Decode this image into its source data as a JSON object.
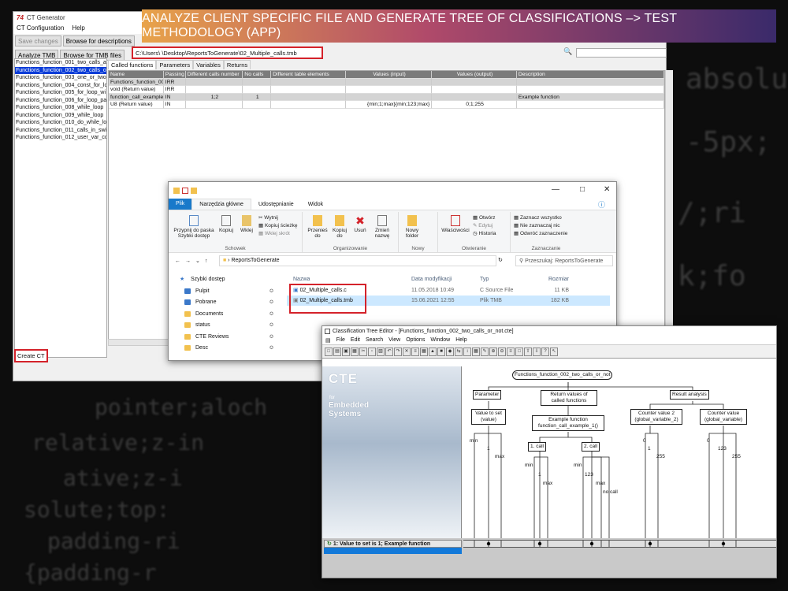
{
  "banner": "ANALYZE CLIENT SPECIFIC FILE AND GENERATE TREE OF CLASSIFICATIONS –> TEST METHODOLOGY (APP)",
  "bg_code": [
    "absolu",
    "-5px;",
    "/;ri",
    "k;fo",
    "pointer;aloch",
    "relative;z-in",
    "ative;z-i",
    "solute;top:",
    "padding-ri",
    "{padding-r"
  ],
  "ctgen": {
    "title": "CT Generator",
    "menu": [
      "CT Configuration",
      "Help"
    ],
    "toolbar1": [
      "Save changes",
      "Browse for descriptions"
    ],
    "toolbar2": [
      "Analyze TMB",
      "Browse for TMB files"
    ],
    "path": "C:\\Users\\                    \\Desktop\\ReportsToGenerate\\02_Multiple_calls.tmb",
    "functions": [
      "Functions_function_001_two_calls_al",
      "Functions_function_002_two_calls_or_",
      "Functions_function_003_one_or_two",
      "Functions_function_004_const_for_lo",
      "Functions_function_005_for_loop_wi",
      "Functions_function_006_for_loop_pa",
      "Functions_function_008_while_loop",
      "Functions_function_009_while_loop",
      "Functions_function_010_do_while_lo",
      "Functions_function_011_calls_in_swi",
      "Functions_function_012_user_var_co"
    ],
    "tabs": [
      "Called functions",
      "Parameters",
      "Variables",
      "Returns"
    ],
    "columns": [
      "Name",
      "Passing",
      "Different calls number",
      "No calls",
      "Different table elements",
      "Values (input)",
      "Values (output)",
      "Description"
    ],
    "rows": [
      [
        "Functions_function_001",
        "IRR",
        "",
        "",
        "",
        "",
        "",
        ""
      ],
      [
        "void (Return value)",
        "IRR",
        "",
        "",
        "",
        "",
        "",
        ""
      ],
      [
        "function_call_example_",
        "IN",
        "1;2",
        "1",
        "",
        "",
        "",
        "Example function"
      ],
      [
        "U8 (Return value)",
        "IN",
        "",
        "",
        "",
        "{min;1;max}{min;123;max}",
        "0;1;255",
        ""
      ]
    ],
    "create_btn": "Create CT"
  },
  "explorer": {
    "tabs": [
      "Plik",
      "Narzędzia główne",
      "Udostępnianie",
      "Widok"
    ],
    "groups": [
      "Schowek",
      "Organizowanie",
      "Nowy",
      "Otwieranie",
      "Zaznaczanie"
    ],
    "buttons": {
      "pin": "Przypnij do paska Szybki dostęp",
      "copy": "Kopiuj",
      "paste": "Wklej",
      "cut": "Wytnij",
      "copypath": "Kopiuj ścieżkę",
      "pasteshort": "Wklej skrót",
      "moveto": "Przenieś do",
      "copyto": "Kopiuj do",
      "delete": "Usuń",
      "rename": "Zmień nazwę",
      "newfolder": "Nowy folder",
      "props": "Właściwości",
      "open": "Otwórz",
      "edit": "Edytuj",
      "history": "Historia",
      "selall": "Zaznacz wszystko",
      "selnone": "Nie zaznaczaj nic",
      "invert": "Odwróć zaznaczenie"
    },
    "address": "ReportsToGenerate",
    "search": "Przeszukaj: ReportsToGenerate",
    "nav": [
      "Szybki dostęp",
      "Pulpit",
      "Pobrane",
      "Documents",
      "status",
      "CTE Reviews",
      "Desc"
    ],
    "columns": [
      "Nazwa",
      "Data modyfikacji",
      "Typ",
      "Rozmiar"
    ],
    "files": [
      {
        "name": "02_Multiple_calls.c",
        "date": "11.05.2018 10:49",
        "type": "C Source File",
        "size": "11 KB"
      },
      {
        "name": "02_Multiple_calls.tmb",
        "date": "15.06.2021 12:55",
        "type": "Plik TMB",
        "size": "182 KB"
      }
    ]
  },
  "cte": {
    "title": "Classification Tree Editor - [Functions_function_002_two_calls_or_not.cte]",
    "menu": [
      "File",
      "Edit",
      "Search",
      "View",
      "Options",
      "Window",
      "Help"
    ],
    "brand_big": "CTE",
    "brand_for": "for",
    "brand_emb": "Embedded",
    "brand_sys": "Systems",
    "root": "Functions_function_002_two_calls_or_not",
    "nodes": {
      "param": "Parameter",
      "retvals": "Return values of called functions",
      "result": "Result analysis",
      "valueset": "Value to set (value)",
      "example": "Example function function_call_example_1()",
      "counter2": "Counter value 2 (global_variable_2)",
      "counter": "Counter value (global_variable)",
      "call1": "1. call",
      "call2": "2. call"
    },
    "classes": {
      "min": "min",
      "one": "1",
      "max": "max",
      "c123": "123",
      "nocall": "no call",
      "zero": "0",
      "c255": "255"
    },
    "testcase": "1: Value to set is 1; Example function"
  }
}
